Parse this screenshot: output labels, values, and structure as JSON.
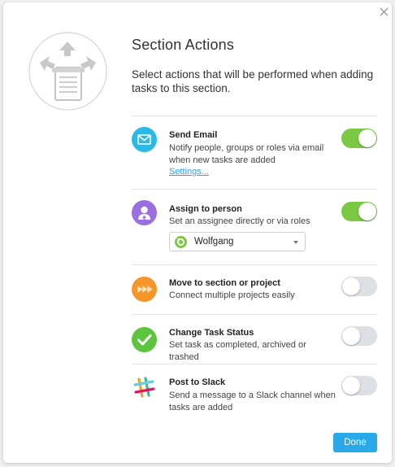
{
  "dialog": {
    "title": "Section Actions",
    "subtitle": "Select actions that will be performed when adding tasks to this section."
  },
  "actions": [
    {
      "title": "Send Email",
      "description": "Notify people, groups or roles via email when new tasks are added",
      "link": "Settings...",
      "enabled": true,
      "icon": "email-icon",
      "color": "#2bb9e6"
    },
    {
      "title": "Assign to person",
      "description": "Set an assignee directly or via roles",
      "assignee": "Wolfgang",
      "enabled": true,
      "icon": "person-icon",
      "color": "#9b6fe0"
    },
    {
      "title": "Move to section or project",
      "description": "Connect multiple projects easily",
      "enabled": false,
      "icon": "double-arrow-icon",
      "color": "#f6952a"
    },
    {
      "title": "Change Task Status",
      "description": "Set task as completed, archived or trashed",
      "enabled": false,
      "icon": "checkmark-icon",
      "color": "#5cc53d"
    },
    {
      "title": "Post to Slack",
      "description": "Send a message to a Slack channel when tasks are added",
      "enabled": false,
      "icon": "slack-icon"
    }
  ],
  "footer": {
    "done_label": "Done"
  },
  "colors": {
    "toggle_on": "#7ac943",
    "toggle_off": "#dcdfe3",
    "link": "#29a3e3",
    "primary_button": "#29a9e8"
  }
}
